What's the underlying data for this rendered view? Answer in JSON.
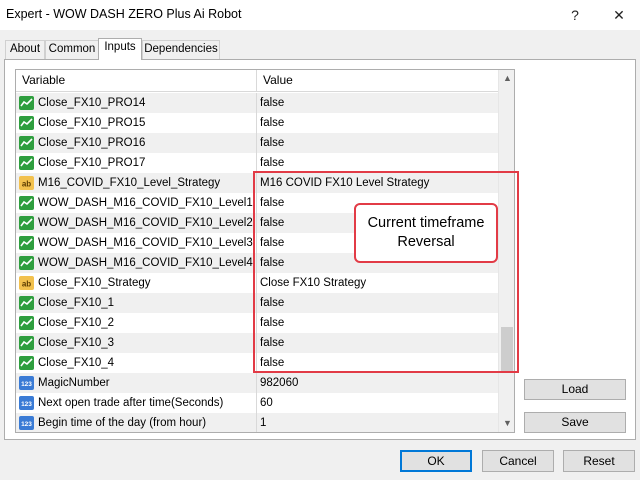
{
  "window": {
    "title": "Expert - WOW DASH ZERO Plus Ai Robot",
    "help_glyph": "?",
    "close_glyph": "✕"
  },
  "tabs": [
    {
      "label": "About",
      "active": false
    },
    {
      "label": "Common",
      "active": false
    },
    {
      "label": "Inputs",
      "active": true
    },
    {
      "label": "Dependencies",
      "active": false
    }
  ],
  "grid": {
    "columns": {
      "variable": "Variable",
      "value": "Value"
    },
    "rows": [
      {
        "icon": "bool",
        "variable": "Close_FX10_PRO14",
        "value": "false"
      },
      {
        "icon": "bool",
        "variable": "Close_FX10_PRO15",
        "value": "false"
      },
      {
        "icon": "bool",
        "variable": "Close_FX10_PRO16",
        "value": "false"
      },
      {
        "icon": "bool",
        "variable": "Close_FX10_PRO17",
        "value": "false"
      },
      {
        "icon": "string",
        "variable": "M16_COVID_FX10_Level_Strategy",
        "value": "M16 COVID FX10 Level Strategy"
      },
      {
        "icon": "bool",
        "variable": "WOW_DASH_M16_COVID_FX10_Level1",
        "value": "false"
      },
      {
        "icon": "bool",
        "variable": "WOW_DASH_M16_COVID_FX10_Level2",
        "value": "false"
      },
      {
        "icon": "bool",
        "variable": "WOW_DASH_M16_COVID_FX10_Level3",
        "value": "false"
      },
      {
        "icon": "bool",
        "variable": "WOW_DASH_M16_COVID_FX10_Level4",
        "value": "false"
      },
      {
        "icon": "string",
        "variable": "Close_FX10_Strategy",
        "value": "Close FX10 Strategy"
      },
      {
        "icon": "bool",
        "variable": "Close_FX10_1",
        "value": "false"
      },
      {
        "icon": "bool",
        "variable": "Close_FX10_2",
        "value": "false"
      },
      {
        "icon": "bool",
        "variable": "Close_FX10_3",
        "value": "false"
      },
      {
        "icon": "bool",
        "variable": "Close_FX10_4",
        "value": "false"
      },
      {
        "icon": "int",
        "variable": "MagicNumber",
        "value": "982060"
      },
      {
        "icon": "int",
        "variable": "Next open trade after time(Seconds)",
        "value": "60"
      },
      {
        "icon": "int",
        "variable": "Begin time of the day (from hour)",
        "value": "1"
      }
    ],
    "scroll_position": 0.85
  },
  "annotation": {
    "line1": "Current timeframe",
    "line2": "Reversal",
    "color": "#e23b46"
  },
  "side_buttons": {
    "load": "Load",
    "save": "Save"
  },
  "bottom_buttons": {
    "ok": "OK",
    "cancel": "Cancel",
    "reset": "Reset"
  },
  "colors": {
    "bool_icon": "#2e9e3e",
    "string_icon": "#f2c14e",
    "int_icon": "#3a7bd5",
    "focus_border": "#0078d7"
  }
}
